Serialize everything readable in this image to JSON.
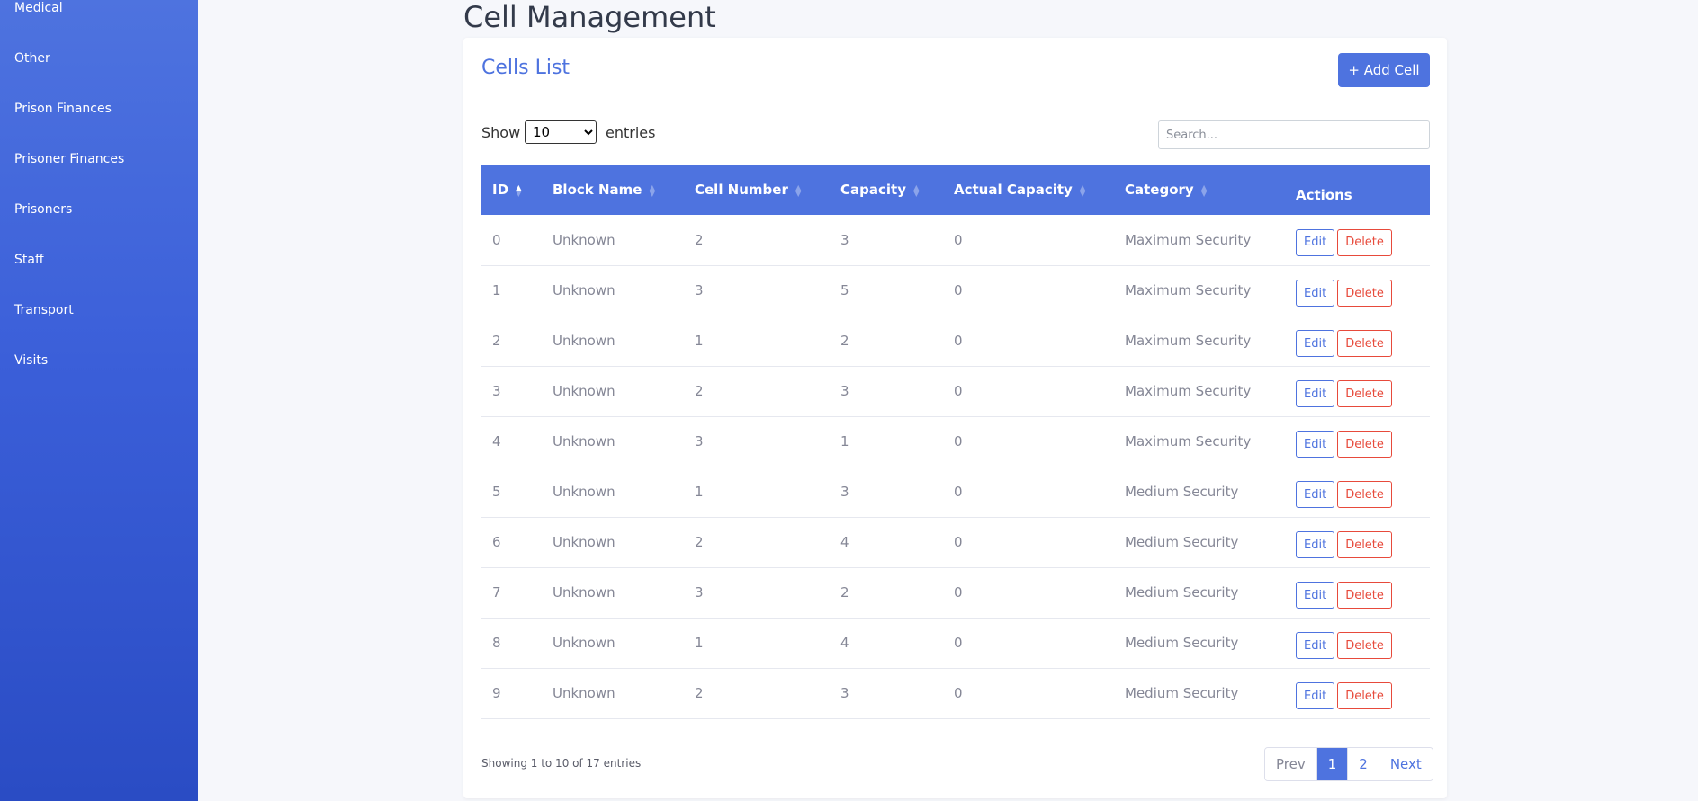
{
  "sidebar": {
    "items": [
      {
        "label": "Medical"
      },
      {
        "label": "Other"
      },
      {
        "label": "Prison Finances"
      },
      {
        "label": "Prisoner Finances"
      },
      {
        "label": "Prisoners"
      },
      {
        "label": "Staff"
      },
      {
        "label": "Transport"
      },
      {
        "label": "Visits"
      }
    ]
  },
  "page": {
    "title": "Cell Management"
  },
  "card": {
    "title": "Cells List",
    "add_button": "+ Add Cell"
  },
  "length": {
    "show_label": "Show",
    "selected": "10",
    "entries_label": "entries"
  },
  "search": {
    "placeholder": "Search..."
  },
  "table": {
    "columns": [
      "ID",
      "Block Name",
      "Cell Number",
      "Capacity",
      "Actual Capacity",
      "Category",
      "Actions"
    ],
    "rows": [
      {
        "id": "0",
        "block": "Unknown",
        "cell": "2",
        "capacity": "3",
        "actual": "0",
        "category": "Maximum Security"
      },
      {
        "id": "1",
        "block": "Unknown",
        "cell": "3",
        "capacity": "5",
        "actual": "0",
        "category": "Maximum Security"
      },
      {
        "id": "2",
        "block": "Unknown",
        "cell": "1",
        "capacity": "2",
        "actual": "0",
        "category": "Maximum Security"
      },
      {
        "id": "3",
        "block": "Unknown",
        "cell": "2",
        "capacity": "3",
        "actual": "0",
        "category": "Maximum Security"
      },
      {
        "id": "4",
        "block": "Unknown",
        "cell": "3",
        "capacity": "1",
        "actual": "0",
        "category": "Maximum Security"
      },
      {
        "id": "5",
        "block": "Unknown",
        "cell": "1",
        "capacity": "3",
        "actual": "0",
        "category": "Medium Security"
      },
      {
        "id": "6",
        "block": "Unknown",
        "cell": "2",
        "capacity": "4",
        "actual": "0",
        "category": "Medium Security"
      },
      {
        "id": "7",
        "block": "Unknown",
        "cell": "3",
        "capacity": "2",
        "actual": "0",
        "category": "Medium Security"
      },
      {
        "id": "8",
        "block": "Unknown",
        "cell": "1",
        "capacity": "4",
        "actual": "0",
        "category": "Medium Security"
      },
      {
        "id": "9",
        "block": "Unknown",
        "cell": "2",
        "capacity": "3",
        "actual": "0",
        "category": "Medium Security"
      }
    ],
    "edit_label": "Edit",
    "delete_label": "Delete"
  },
  "footer": {
    "info": "Showing 1 to 10 of 17 entries",
    "pagination": {
      "prev": "Prev",
      "pages": [
        "1",
        "2"
      ],
      "active": "1",
      "next": "Next"
    }
  },
  "colors": {
    "primary": "#4e73df",
    "danger": "#e74a3b",
    "muted": "#858796"
  }
}
